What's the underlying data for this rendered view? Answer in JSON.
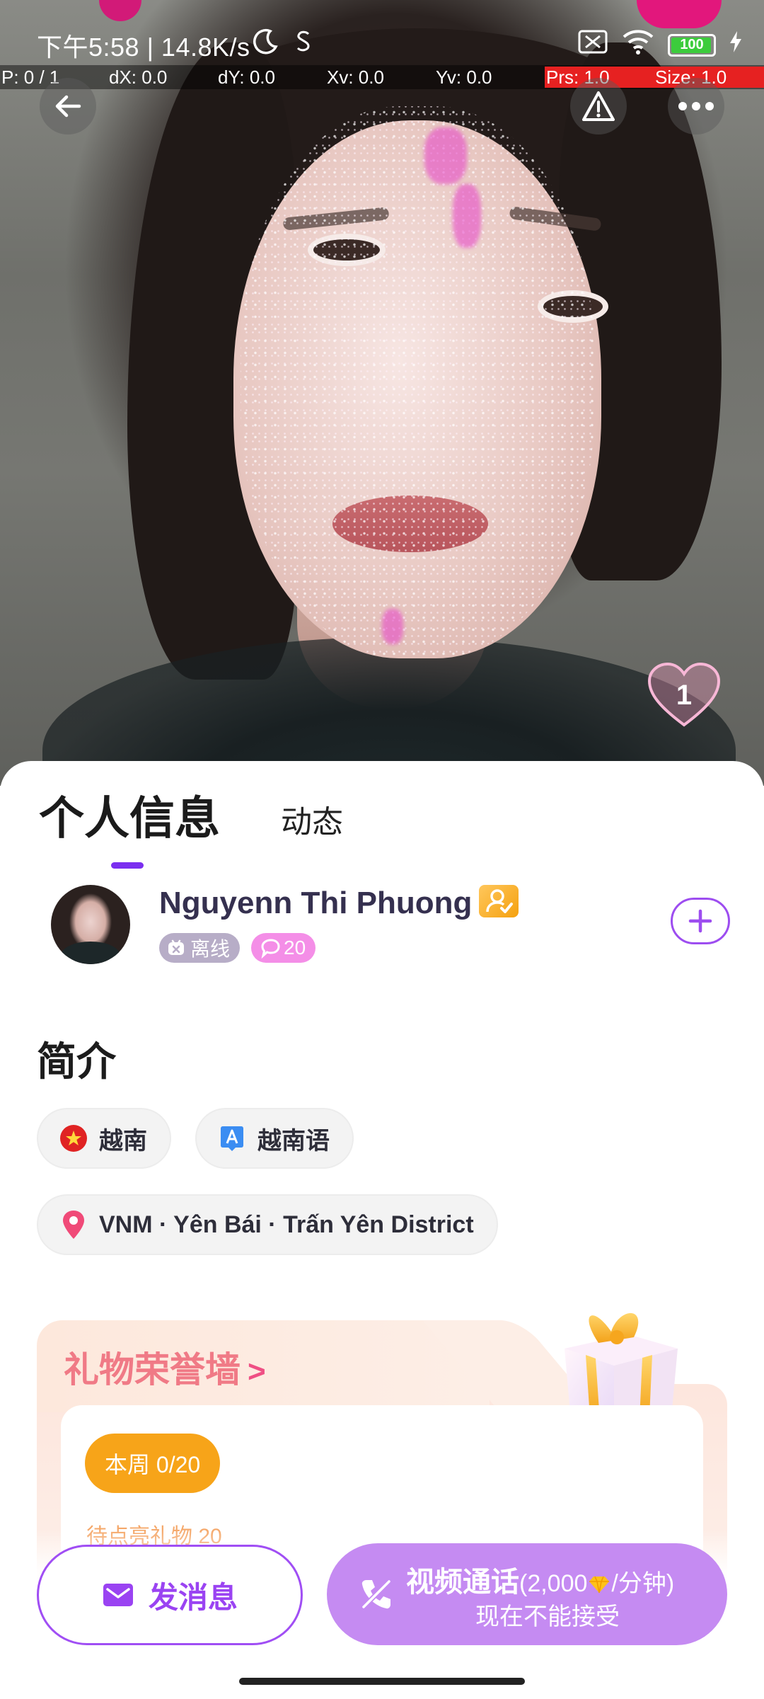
{
  "status_bar": {
    "time_text": "下午5:58 | 14.8K/s",
    "battery": "100"
  },
  "debug_overlay": {
    "p": "P: 0 / 1",
    "dx": "dX: 0.0",
    "dy": "dY: 0.0",
    "xv": "Xv: 0.0",
    "yv": "Yv: 0.0",
    "prs": "Prs: 1.0",
    "size": "Size: 1.0"
  },
  "photo": {
    "like_count": "1"
  },
  "tabs": {
    "active": "个人信息",
    "second": "动态"
  },
  "profile": {
    "name": "Nguyenn Thi Phuong",
    "status": "离线",
    "level": "20"
  },
  "intro": {
    "title": "简介",
    "country": "越南",
    "language": "越南语",
    "location": "VNM · Yên Bái · Trấn Yên District"
  },
  "gift_wall": {
    "title": "礼物荣誉墙",
    "arrow": ">",
    "week_progress": "本周 0/20",
    "hint": "待点亮礼物 20"
  },
  "actions": {
    "message_label": "发消息",
    "call_label": "视频通话",
    "call_price_prefix": "(2,000",
    "call_price_suffix": "/分钟)",
    "call_status": "现在不能接受"
  },
  "colors": {
    "accent": "#9a43f2",
    "tab_indicator": "#7b2ff0",
    "call_button": "#c58bf2",
    "week_pill": "#f7a419",
    "gift_title": "#f07a86"
  }
}
